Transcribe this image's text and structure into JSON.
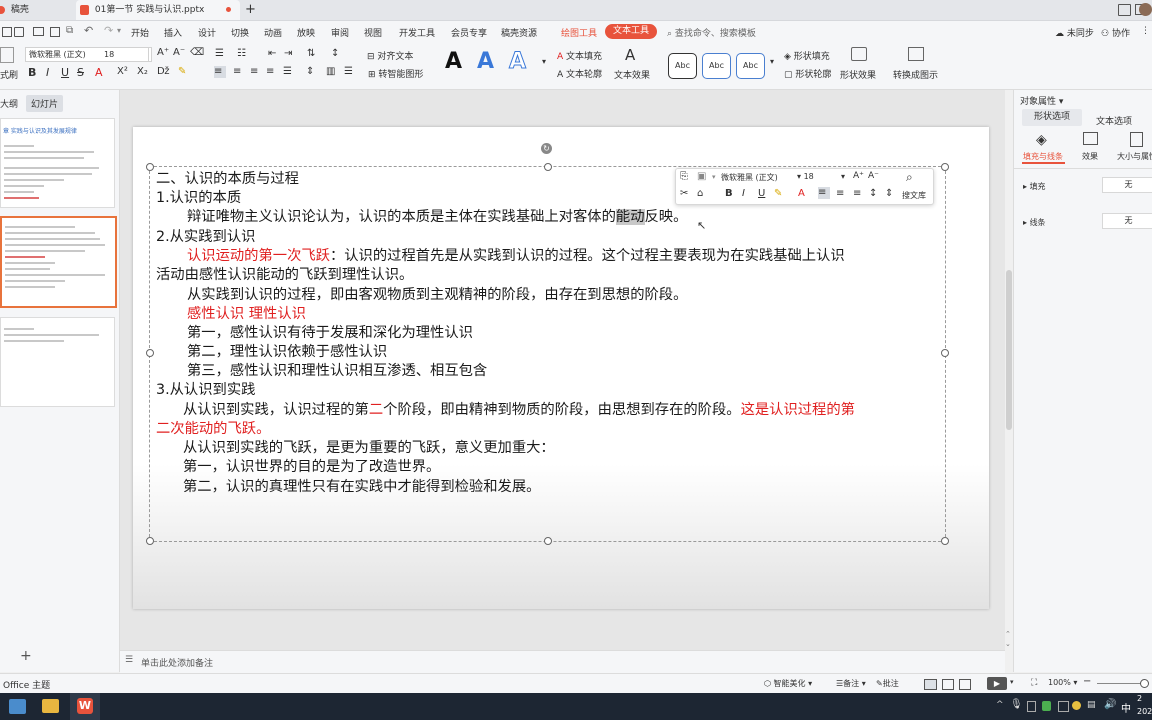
{
  "titlebar": {
    "home_tab": "稿壳",
    "doc_tab": "01第一节 实践与认识.pptx",
    "new_tab": "+"
  },
  "menu": {
    "items": [
      "开始",
      "插入",
      "设计",
      "切换",
      "动画",
      "放映",
      "审阅",
      "视图",
      "开发工具",
      "会员专享",
      "稿壳资源",
      "绘图工具"
    ],
    "active": "文本工具",
    "search_placeholder": "查找命令、搜索模板",
    "sync": "未同步",
    "collab": "协作"
  },
  "ribbon": {
    "font_name": "微软雅黑 (正文)",
    "font_size": "18",
    "align_text": "对齐文本",
    "smart_graphic": "转智能图形",
    "text_fill": "文本填充",
    "text_outline": "文本轮廓",
    "text_effect": "文本效果",
    "shape_fill": "形状填充",
    "shape_outline": "形状轮廓",
    "shape_effect": "形状效果",
    "convert_image": "转换成图示",
    "style_label": "Abc",
    "format_label": "式刷",
    "big_a": "A"
  },
  "leftpanel": {
    "tab_outline": "大纲",
    "tab_slides": "幻灯片",
    "thumb1_title": "章 实践与认识及其发展规律",
    "add": "+"
  },
  "slide": {
    "lines": [
      {
        "segments": [
          {
            "t": "二、认识的本质与过程"
          }
        ]
      },
      {
        "segments": [
          {
            "t": "1.认识的本质"
          }
        ]
      },
      {
        "segments": [
          {
            "t": "辩证唯物主义认识论认为，认识的本质是主体在实践基础上对客体的"
          },
          {
            "t": "能动",
            "hl": true
          },
          {
            "t": "反映。"
          }
        ]
      },
      {
        "segments": [
          {
            "t": "2.从实践到认识"
          }
        ]
      },
      {
        "segments": [
          {
            "t": "认识运动的第一次飞跃",
            "red": true
          },
          {
            "t": "：认识的过程首先是从实践到认识的过程。这个过程主要表现为在实践基础上认识"
          }
        ]
      },
      {
        "segments": [
          {
            "t": "活动由感性认识能动的飞跃到理性认识。"
          }
        ]
      },
      {
        "segments": [
          {
            "t": "从实践到认识的过程，即由客观物质到主观精神的阶段，由存在到思想的阶段。"
          }
        ]
      },
      {
        "segments": [
          {
            "t": "感性认识   理性认识",
            "red": true
          }
        ]
      },
      {
        "segments": [
          {
            "t": "第一，感性认识有待于发展和深化为理性认识"
          }
        ]
      },
      {
        "segments": [
          {
            "t": "第二，理性认识依赖于感性认识"
          }
        ]
      },
      {
        "segments": [
          {
            "t": "第三，感性认识和理性认识相互渗透、相互包含"
          }
        ]
      },
      {
        "segments": [
          {
            "t": "3.从认识到实践"
          }
        ]
      },
      {
        "segments": [
          {
            "t": "从认识到实践，认识过程的第"
          },
          {
            "t": "二",
            "red": true
          },
          {
            "t": "个阶段，即由精神到物质的阶段，由思想到存在的阶段。"
          },
          {
            "t": "这是认识过程的第",
            "red": true
          }
        ]
      },
      {
        "segments": [
          {
            "t": "二次能动的飞跃。",
            "red": true
          }
        ]
      },
      {
        "segments": [
          {
            "t": "从认识到实践的飞跃，是更为重要的飞跃，意义更加重大："
          }
        ]
      },
      {
        "segments": [
          {
            "t": "第一，认识世界的目的是为了改造世界。"
          }
        ]
      },
      {
        "segments": [
          {
            "t": "第二，认识的真理性只有在实践中才能得到检验和发展。"
          }
        ]
      }
    ]
  },
  "floatbar": {
    "font_name": "微软雅黑 (正文)",
    "font_size": "18",
    "library": "搜文库"
  },
  "notes": {
    "placeholder": "单击此处添加备注"
  },
  "rightpanel": {
    "title": "对象属性",
    "tab_shape": "形状选项",
    "tab_text": "文本选项",
    "sub_fill": "填充与线条",
    "sub_effect": "效果",
    "sub_size": "大小与属性",
    "fill_label": "填充",
    "fill_value": "无",
    "line_label": "线条",
    "line_value": "无"
  },
  "status": {
    "theme": "Office 主题",
    "beautify": "智能美化",
    "notes": "备注",
    "comment": "批注",
    "zoom": "100%"
  },
  "taskbar": {
    "ime": "中",
    "year": "202",
    "time_top": "2"
  },
  "colors": {
    "accent": "#e8533c",
    "red_text": "#e02020",
    "taskbar": "#1d2633"
  }
}
